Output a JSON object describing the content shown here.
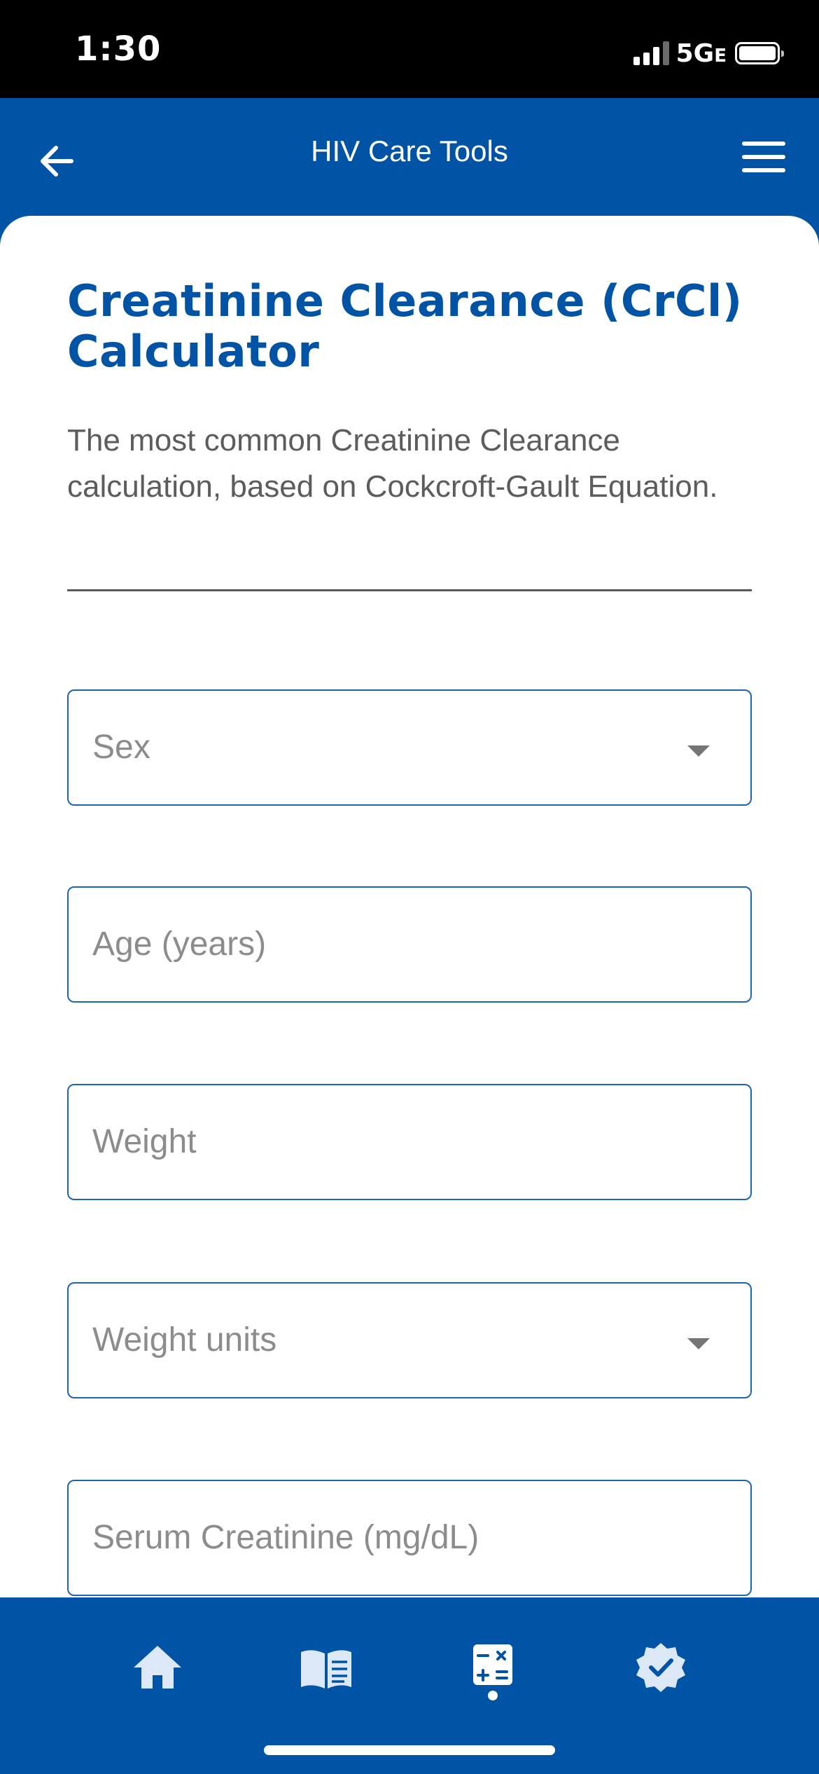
{
  "status_bar": {
    "time": "1:30",
    "network": "5G",
    "network_suffix": "E"
  },
  "header": {
    "title": "HIV Care Tools"
  },
  "page": {
    "title": "Creatinine Clearance (CrCl) Calculator",
    "description": "The most common Creatinine Clearance calculation, based on Cockcroft-Gault Equation."
  },
  "form": {
    "sex_placeholder": "Sex",
    "age_placeholder": "Age (years)",
    "weight_placeholder": "Weight",
    "weight_units_placeholder": "Weight units",
    "serum_creatinine_placeholder": "Serum Creatinine (mg/dL)"
  },
  "bottom_nav": {
    "items": [
      {
        "icon": "home-icon"
      },
      {
        "icon": "book-icon"
      },
      {
        "icon": "calculator-icon",
        "active": true
      },
      {
        "icon": "verified-badge-icon"
      }
    ]
  },
  "colors": {
    "brand": "#0053a5",
    "status_bar": "#000000",
    "field_border": "#1f64b1"
  }
}
